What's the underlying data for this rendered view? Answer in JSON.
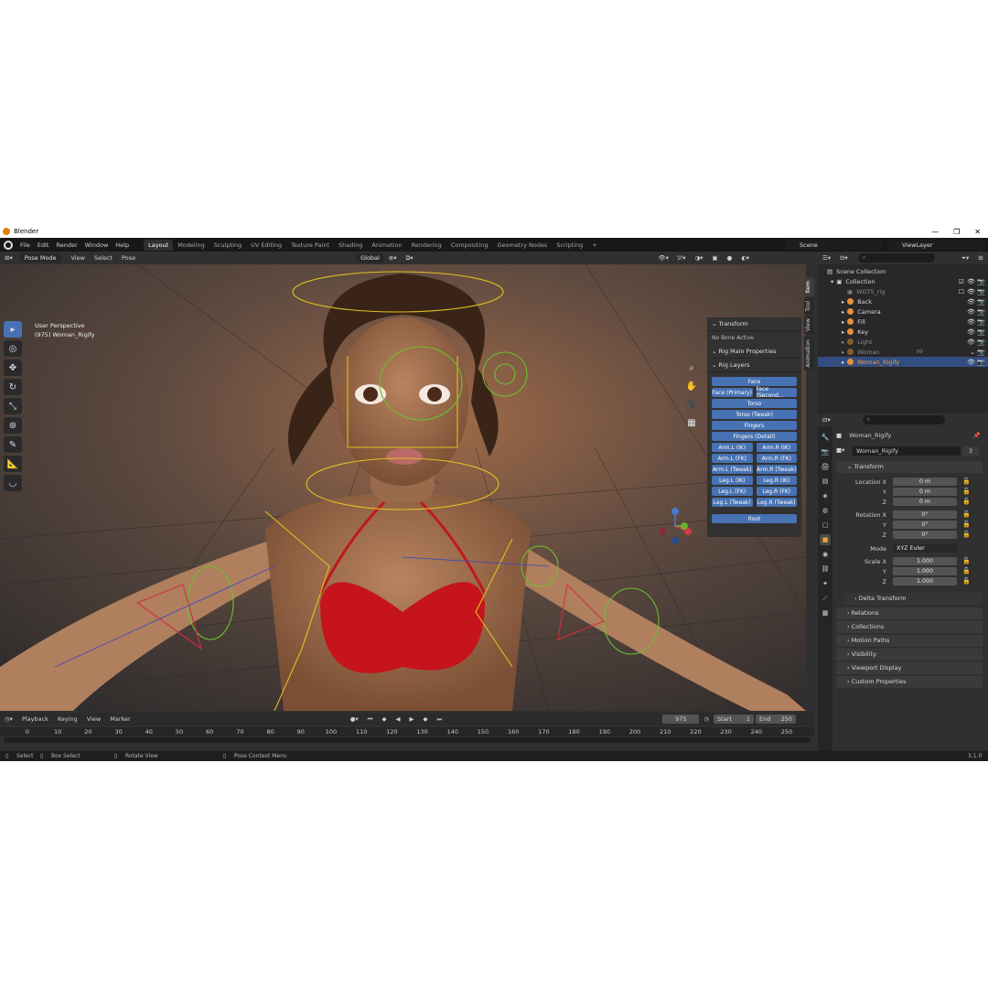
{
  "window": {
    "title": "Blender",
    "controls": [
      "—",
      "❐",
      "✕"
    ]
  },
  "menus": [
    "File",
    "Edit",
    "Render",
    "Window",
    "Help"
  ],
  "workspaces": [
    "Layout",
    "Modeling",
    "Sculpting",
    "UV Editing",
    "Texture Paint",
    "Shading",
    "Animation",
    "Rendering",
    "Compositing",
    "Geometry Nodes",
    "Scripting"
  ],
  "active_workspace": "Layout",
  "scene": {
    "scene_name": "Scene",
    "view_layer": "ViewLayer"
  },
  "viewport_header": {
    "mode": "Pose Mode",
    "menus": [
      "View",
      "Select",
      "Pose"
    ],
    "orientation": "Global",
    "pose_options": "Pose Options"
  },
  "viewport": {
    "perspective": "User Perspective",
    "object_info": "(975) Woman_Rigify"
  },
  "npanel": {
    "transform_header": "Transform",
    "no_bone": "No Bone Active",
    "rig_main": "Rig Main Properties",
    "rig_layers": "Rig Layers",
    "buttons": {
      "face": "Face",
      "face_primary": "Face (Primary)",
      "face_secondary": "Face (Second...",
      "torso": "Torso",
      "torso_tweak": "Torso (Tweak)",
      "fingers": "Fingers",
      "fingers_detail": "Fingers (Detail)",
      "arm_l_ik": "Arm.L (IK)",
      "arm_r_ik": "Arm.R (IK)",
      "arm_l_fk": "Arm.L (FK)",
      "arm_r_fk": "Arm.R (FK)",
      "arm_l_tweak": "Arm.L (Tweak)",
      "arm_r_tweak": "Arm.R (Tweak)",
      "leg_l_ik": "Leg.L (IK)",
      "leg_r_ik": "Leg.R (IK)",
      "leg_l_fk": "Leg.L (FK)",
      "leg_r_fk": "Leg.R (FK)",
      "leg_l_tweak": "Leg.L (Tweak)",
      "leg_r_tweak": "Leg.R (Tweak)",
      "root": "Root"
    },
    "tabs": [
      "Item",
      "Tool",
      "View",
      "Animation"
    ]
  },
  "outliner": {
    "rows": [
      {
        "label": "Scene Collection"
      },
      {
        "label": "Collection"
      },
      {
        "label": "WGTS_rig"
      },
      {
        "label": "Back"
      },
      {
        "label": "Camera"
      },
      {
        "label": "Fill"
      },
      {
        "label": "Key"
      },
      {
        "label": "Light"
      },
      {
        "label": "Woman"
      },
      {
        "label": "Woman_Rigify"
      }
    ],
    "woman_count": "99"
  },
  "properties": {
    "object_name": "Woman_Rigify",
    "data_name": "Woman_Rigify",
    "users": "3",
    "transform": "Transform",
    "location_x_label": "Location X",
    "location_x": "0 m",
    "location_y_label": "Y",
    "location_y": "0 m",
    "location_z_label": "Z",
    "location_z": "0 m",
    "rotation_x_label": "Rotation X",
    "rotation_x": "0°",
    "rotation_y_label": "Y",
    "rotation_y": "0°",
    "rotation_z_label": "Z",
    "rotation_z": "0°",
    "mode_label": "Mode",
    "mode": "XYZ Euler",
    "scale_x_label": "Scale X",
    "scale_x": "1.000",
    "scale_y_label": "Y",
    "scale_y": "1.000",
    "scale_z_label": "Z",
    "scale_z": "1.000",
    "sections": [
      "Delta Transform",
      "Relations",
      "Collections",
      "Motion Paths",
      "Visibility",
      "Viewport Display",
      "Custom Properties"
    ]
  },
  "timeline": {
    "menus": [
      "Playback",
      "Keying",
      "View",
      "Marker"
    ],
    "current_frame": "975",
    "start_label": "Start",
    "start": "1",
    "end_label": "End",
    "end": "250",
    "ticks": [
      "0",
      "10",
      "20",
      "30",
      "40",
      "50",
      "60",
      "70",
      "80",
      "90",
      "100",
      "110",
      "120",
      "130",
      "140",
      "150",
      "160",
      "170",
      "180",
      "190",
      "200",
      "210",
      "220",
      "230",
      "240",
      "250"
    ]
  },
  "statusbar": {
    "select": "Select",
    "box_select": "Box Select",
    "rotate_view": "Rotate View",
    "context_menu": "Pose Context Menu",
    "version": "3.1.0"
  }
}
